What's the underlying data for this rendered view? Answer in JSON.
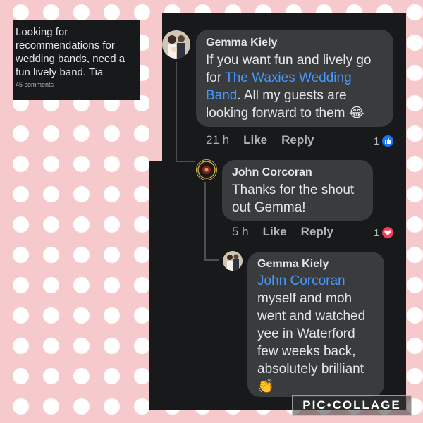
{
  "post": {
    "text": "Looking for recommendations for wedding bands, need a fun lively band. Tia",
    "comments": "45 comments"
  },
  "comments": [
    {
      "name": "Gemma Kiely",
      "text_before": "If you want fun and lively go for ",
      "link": "The Waxies Wedding Band",
      "text_after": ". All my guests are looking forward to them ",
      "emoji": "😂",
      "time": "21 h",
      "like": "Like",
      "reply": "Reply",
      "reaction_count": "1",
      "reaction_icon": "thumbs-up-icon",
      "reaction_color": "#1877f2"
    },
    {
      "name": "John Corcoran",
      "text": "Thanks for the shout out Gemma!",
      "time": "5 h",
      "like": "Like",
      "reply": "Reply",
      "reaction_count": "1",
      "reaction_icon": "heart-icon",
      "reaction_color": "#f33e58"
    },
    {
      "name": "Gemma Kiely",
      "mention": "John Corcoran",
      "text": "myself and moh went and watched yee in Waterford few weeks back, absolutely brilliant",
      "emoji": "👏"
    }
  ],
  "watermark": "PIC•COLLAGE"
}
